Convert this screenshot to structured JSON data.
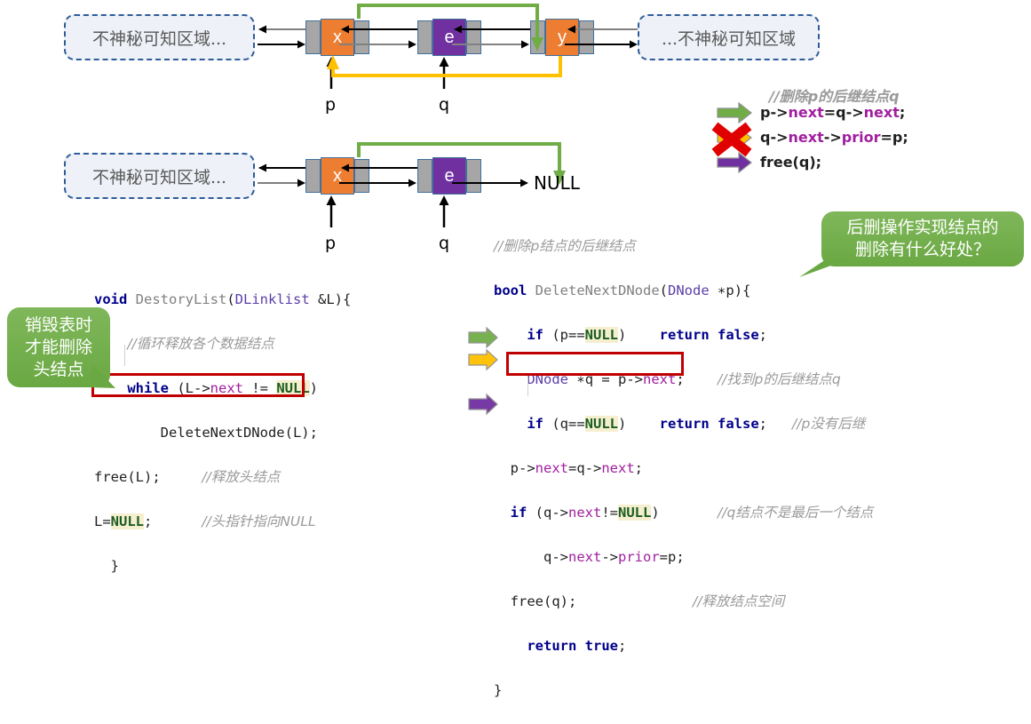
{
  "diagram_top": {
    "left_region_label": "不神秘可知区域...",
    "right_region_label": "...不神秘可知区域",
    "nodes": [
      {
        "value": "x",
        "color": "#ed7d31"
      },
      {
        "value": "e",
        "color": "#7030a0"
      },
      {
        "value": "y",
        "color": "#ed7d31"
      }
    ],
    "pointer_labels": [
      "p",
      "q"
    ],
    "green_arrow_color": "#70ad47",
    "orange_arrow_color": "#ffc000"
  },
  "diagram_bottom": {
    "left_region_label": "不神秘可知区域...",
    "nodes": [
      {
        "value": "x",
        "color": "#ed7d31"
      },
      {
        "value": "e",
        "color": "#7030a0"
      }
    ],
    "null_label": "NULL",
    "pointer_labels": [
      "p",
      "q"
    ],
    "green_arrow_color": "#70ad47"
  },
  "pseudo_code": {
    "comment": "//删除p的后继结点q",
    "lines": [
      {
        "arrow_color": "green",
        "text_parts": [
          "p->",
          "next",
          "=q->",
          "next",
          ";"
        ]
      },
      {
        "arrow_color": "orange",
        "text_parts": [
          "q->",
          "next",
          "->",
          "prior",
          "=p;"
        ]
      },
      {
        "arrow_color": "purple",
        "text_parts": [
          "free(q);"
        ]
      }
    ],
    "cross_mark": "✕",
    "cross_color": "#e00000"
  },
  "code_left": {
    "lines": [
      "void DestoryList(DLinklist &L){",
      "    //循环释放各个数据结点",
      "    while (L->next != NULL)",
      "        DeleteNextDNode(L);",
      "    free(L);      //释放头结点",
      "    L=NULL;       //头指针指向NULL",
      "}"
    ],
    "highlight_line_text": "free(L);      //释放头结点"
  },
  "code_right": {
    "lines": [
      "//删除p结点的后继结点",
      "bool DeleteNextDNode(DNode *p){",
      "    if (p==NULL)    return false;",
      "    DNode *q = p->next;    //找到p的后继结点q",
      "    if (q==NULL)    return false;    //p没有后继",
      "    p->next=q->next;",
      "    if (q->next!=NULL)    //q结点不是最后一个结点",
      "        q->next->prior=p;",
      "    free(q);               //释放结点空间",
      "    return true;",
      "}"
    ],
    "highlight_line_text": "if (q->next!=NULL)"
  },
  "bubble_left": {
    "lines": [
      "销毁表时",
      "才能删除",
      "头结点"
    ],
    "color": "#70ad47"
  },
  "bubble_right": {
    "lines": [
      "后删操作实现结点的",
      "删除有什么好处？"
    ],
    "color": "#70ad47"
  },
  "colors": {
    "node_pointer": "#a6a6a6",
    "node_border": "#41719c",
    "orange": "#ed7d31",
    "purple": "#7030a0",
    "green": "#70ad47",
    "amber": "#ffc000",
    "red": "#c00000",
    "dashed_border": "#2e5c9a"
  }
}
